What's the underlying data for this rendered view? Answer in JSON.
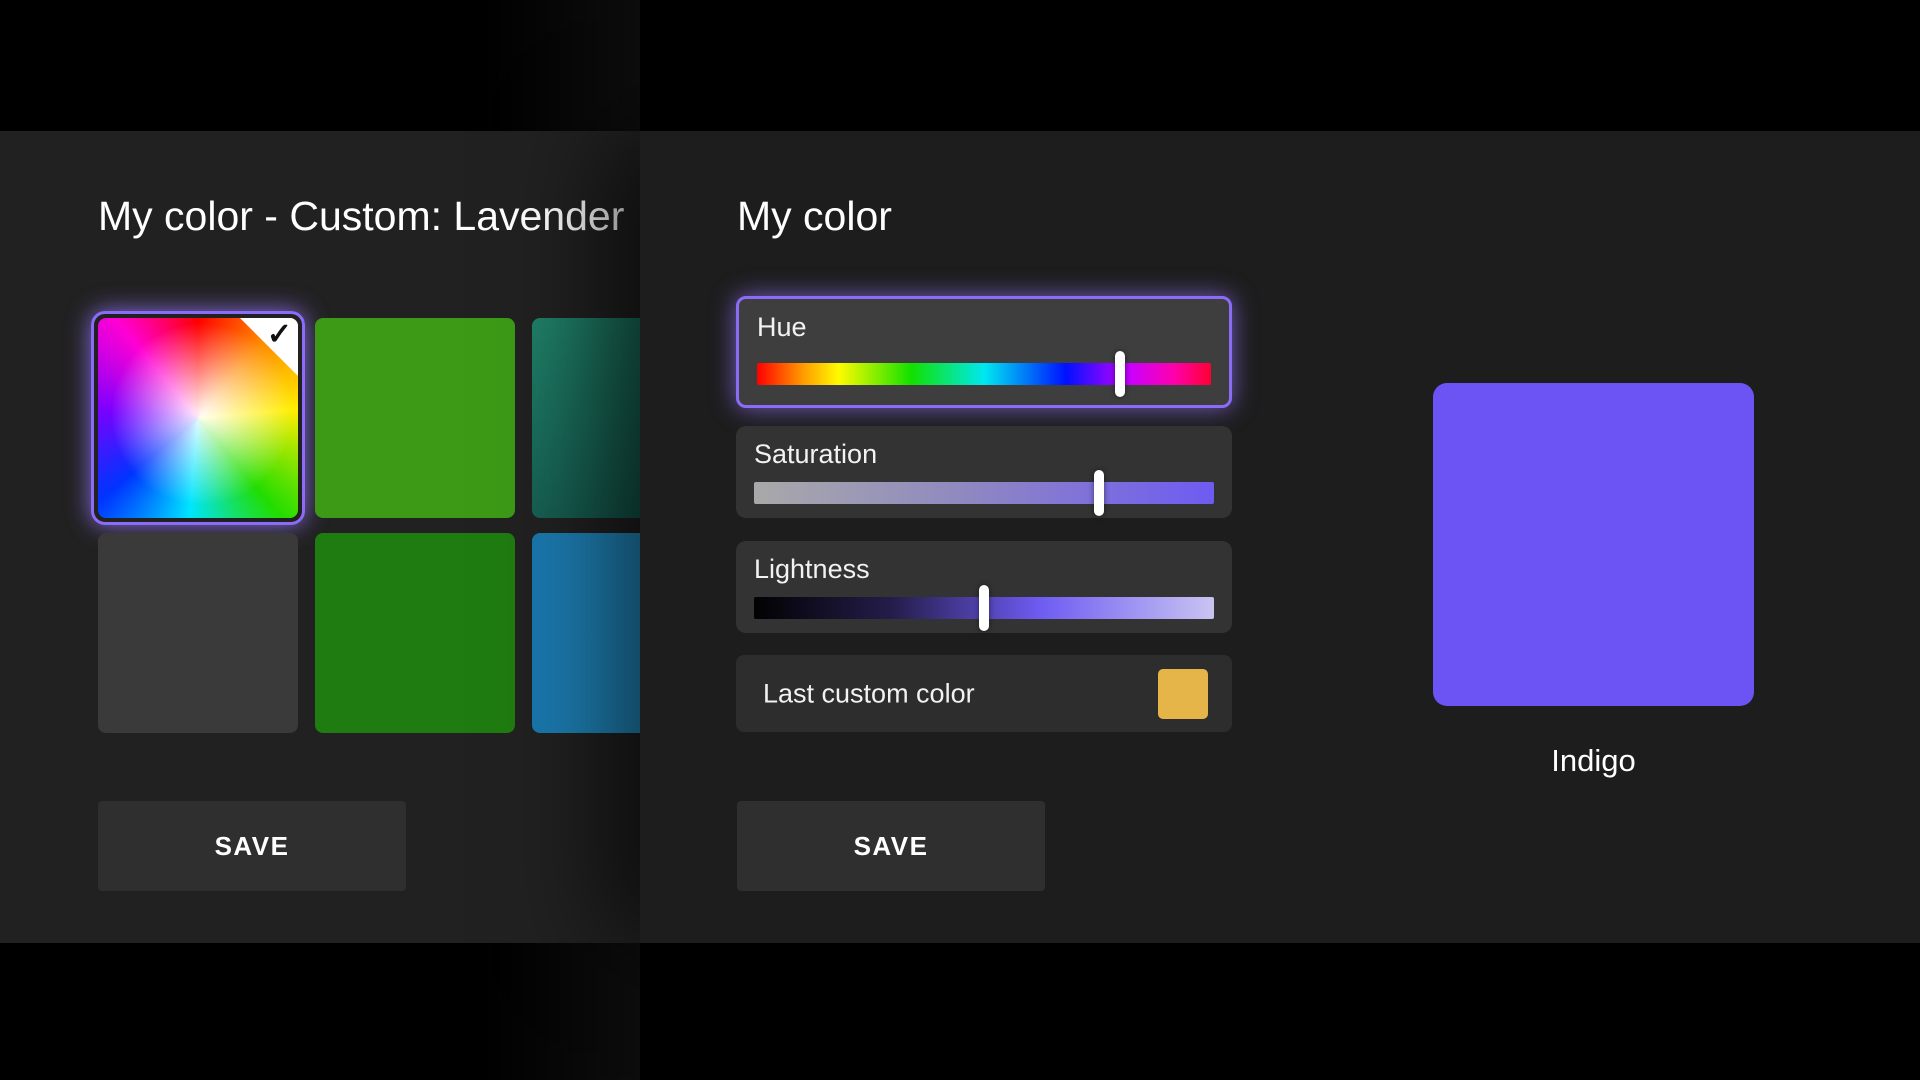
{
  "colors": {
    "page_bg": "#000000",
    "left_panel_bg": "#212121",
    "right_panel_bg": "#1d1d1d",
    "accent_glow": "#8b6cf8"
  },
  "left_panel": {
    "title": "My color - Custom: Lavender",
    "swatches": [
      {
        "name": "custom-spectrum",
        "selected": true
      },
      {
        "name": "green",
        "background": "#3c9a17"
      },
      {
        "name": "teal",
        "background": "linear-gradient(150deg, #1f8068, #124f46)"
      },
      {
        "name": "dark-gray",
        "background": "#3a3a3a"
      },
      {
        "name": "dark-green",
        "background": "#1f7c10"
      },
      {
        "name": "blue",
        "background": "linear-gradient(to right, #1978ad, #2fa7e1)"
      }
    ],
    "save_label": "SAVE"
  },
  "right_panel": {
    "title": "My color",
    "hue": {
      "label": "Hue",
      "thumb_left": "80%"
    },
    "saturation": {
      "label": "Saturation",
      "thumb_left": "75%"
    },
    "lightness": {
      "label": "Lightness",
      "thumb_left": "50%"
    },
    "last_custom": {
      "label": "Last custom color",
      "color": "#e6b54a"
    },
    "save_label": "SAVE",
    "preview": {
      "label": "Indigo",
      "color": "#6b54f3"
    }
  }
}
